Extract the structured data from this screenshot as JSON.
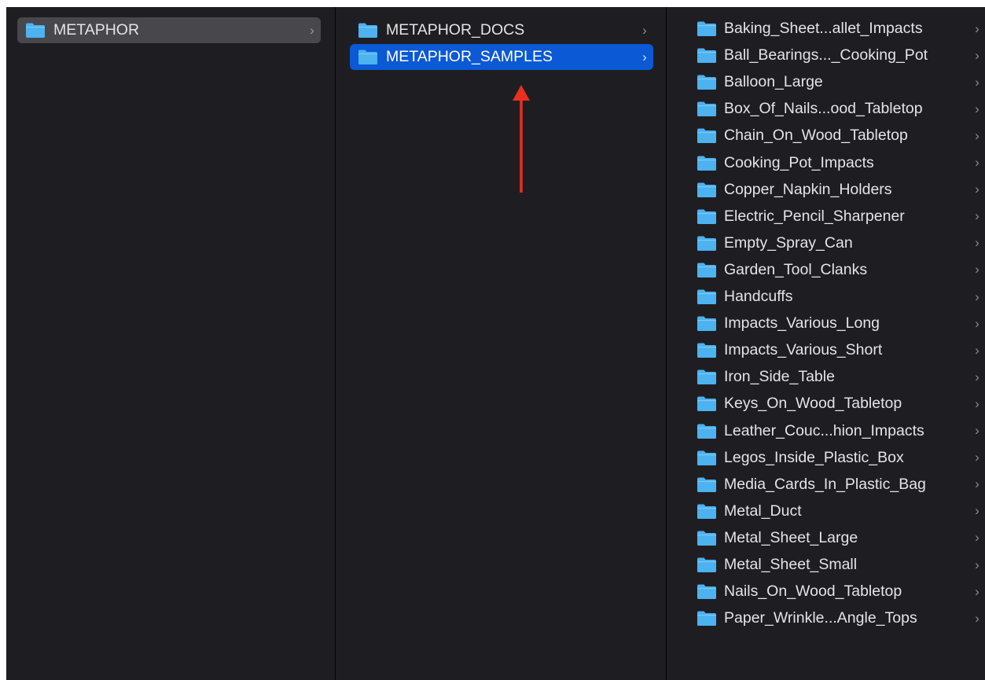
{
  "columns": [
    {
      "items": [
        {
          "label": "METAPHOR",
          "state": "parent-selected"
        }
      ]
    },
    {
      "items": [
        {
          "label": "METAPHOR_DOCS",
          "state": "normal"
        },
        {
          "label": "METAPHOR_SAMPLES",
          "state": "selected"
        }
      ]
    },
    {
      "items": [
        {
          "label": "Baking_Sheet...allet_Impacts",
          "state": "normal"
        },
        {
          "label": "Ball_Bearings..._Cooking_Pot",
          "state": "normal"
        },
        {
          "label": "Balloon_Large",
          "state": "normal"
        },
        {
          "label": "Box_Of_Nails...ood_Tabletop",
          "state": "normal"
        },
        {
          "label": "Chain_On_Wood_Tabletop",
          "state": "normal"
        },
        {
          "label": "Cooking_Pot_Impacts",
          "state": "normal"
        },
        {
          "label": "Copper_Napkin_Holders",
          "state": "normal"
        },
        {
          "label": "Electric_Pencil_Sharpener",
          "state": "normal"
        },
        {
          "label": "Empty_Spray_Can",
          "state": "normal"
        },
        {
          "label": "Garden_Tool_Clanks",
          "state": "normal"
        },
        {
          "label": "Handcuffs",
          "state": "normal"
        },
        {
          "label": "Impacts_Various_Long",
          "state": "normal"
        },
        {
          "label": "Impacts_Various_Short",
          "state": "normal"
        },
        {
          "label": "Iron_Side_Table",
          "state": "normal"
        },
        {
          "label": "Keys_On_Wood_Tabletop",
          "state": "normal"
        },
        {
          "label": "Leather_Couc...hion_Impacts",
          "state": "normal"
        },
        {
          "label": "Legos_Inside_Plastic_Box",
          "state": "normal"
        },
        {
          "label": "Media_Cards_In_Plastic_Bag",
          "state": "normal"
        },
        {
          "label": "Metal_Duct",
          "state": "normal"
        },
        {
          "label": "Metal_Sheet_Large",
          "state": "normal"
        },
        {
          "label": "Metal_Sheet_Small",
          "state": "normal"
        },
        {
          "label": "Nails_On_Wood_Tabletop",
          "state": "normal"
        },
        {
          "label": "Paper_Wrinkle...Angle_Tops",
          "state": "normal"
        }
      ]
    }
  ],
  "icons": {
    "folder": "folder-icon",
    "disclosure": "chevron-right-icon",
    "chevron_glyph": "›"
  },
  "annotation": {
    "icon": "arrow-up-icon",
    "color": "#e8301e"
  },
  "colors": {
    "background": "#1e1e22",
    "selection": "#0b59d5",
    "parent_selection": "#48484c",
    "folder": "#4cb2f0",
    "text": "#e4e4e6"
  }
}
